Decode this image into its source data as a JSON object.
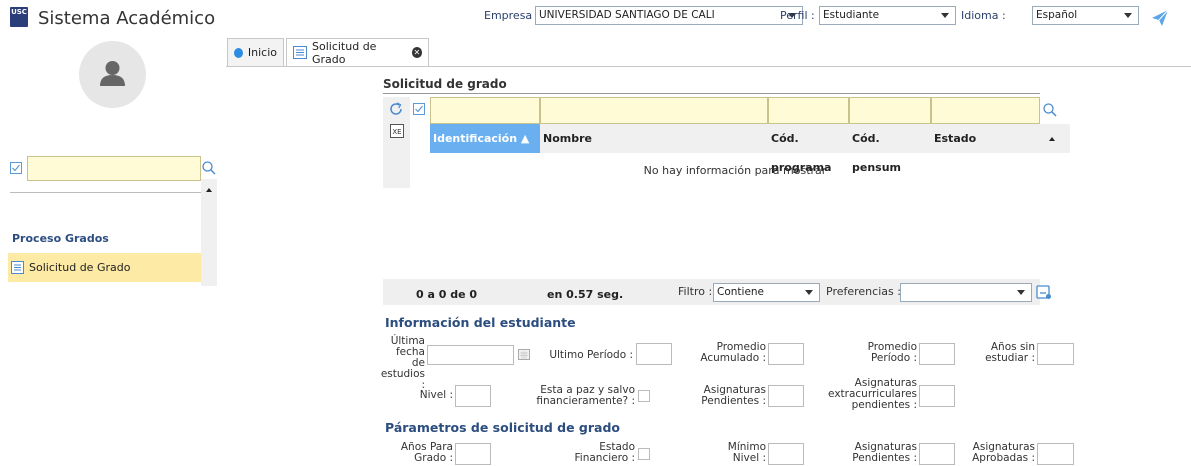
{
  "header": {
    "logo_text": "USC",
    "app_title": "Sistema Académico",
    "empresa_label": "Empresa :",
    "empresa_value": "UNIVERSIDAD SANTIAGO DE CALI",
    "perfil_label": "Perfil :",
    "perfil_value": "Estudiante",
    "idioma_label": "Idioma :",
    "idioma_value": "Español"
  },
  "tabs": [
    {
      "label": "Inicio"
    },
    {
      "label": "Solicitud de Grado"
    }
  ],
  "sidebar": {
    "group_label": "Proceso Grados",
    "items": [
      {
        "label": "Solicitud de Grado"
      }
    ]
  },
  "grid": {
    "title": "Solicitud de grado",
    "columns": [
      "Identificación",
      "Nombre",
      "Cód. programa",
      "Cód. pensum",
      "Estado"
    ],
    "empty_message": "No hay información para mostrar",
    "record_range": "0 a 0 de 0",
    "timing": "en 0.57 seg.",
    "filter_label": "Filtro :",
    "filter_value": "Contiene",
    "prefs_label": "Preferencias :"
  },
  "student_info": {
    "title": "Información del estudiante",
    "ultima_fecha": [
      "Última",
      "fecha de",
      "estudios :"
    ],
    "ultimo_periodo": "Ultimo Período :",
    "promedio_acumulado": [
      "Promedio",
      "Acumulado :"
    ],
    "promedio_periodo": [
      "Promedio",
      "Período :"
    ],
    "anos_sin": [
      "Años sin",
      "estudiar :"
    ],
    "nivel": "Nivel :",
    "paz_salvo": [
      "Esta a paz y salvo",
      "financieramente? :"
    ],
    "asig_pendientes": [
      "Asignaturas",
      "Pendientes :"
    ],
    "asig_extra": [
      "Asignaturas",
      "extracurriculares",
      "pendientes :"
    ]
  },
  "params": {
    "title": "Párametros de solicitud de grado",
    "anos_para": [
      "Años Para",
      "Grado :"
    ],
    "estado_fin": [
      "Estado",
      "Financiero :"
    ],
    "minimo_nivel": [
      "Mínimo",
      "Nivel :"
    ],
    "asig_pendientes": [
      "Asignaturas",
      "Pendientes :"
    ],
    "asig_aprobadas": [
      "Asignaturas",
      "Aprobadas :"
    ]
  },
  "colors": {
    "accent_blue": "#2b4d7f",
    "filter_yellow": "#fffbd6",
    "sorted_header": "#6ab0f0",
    "menu_highlight": "#fdeaa5"
  }
}
